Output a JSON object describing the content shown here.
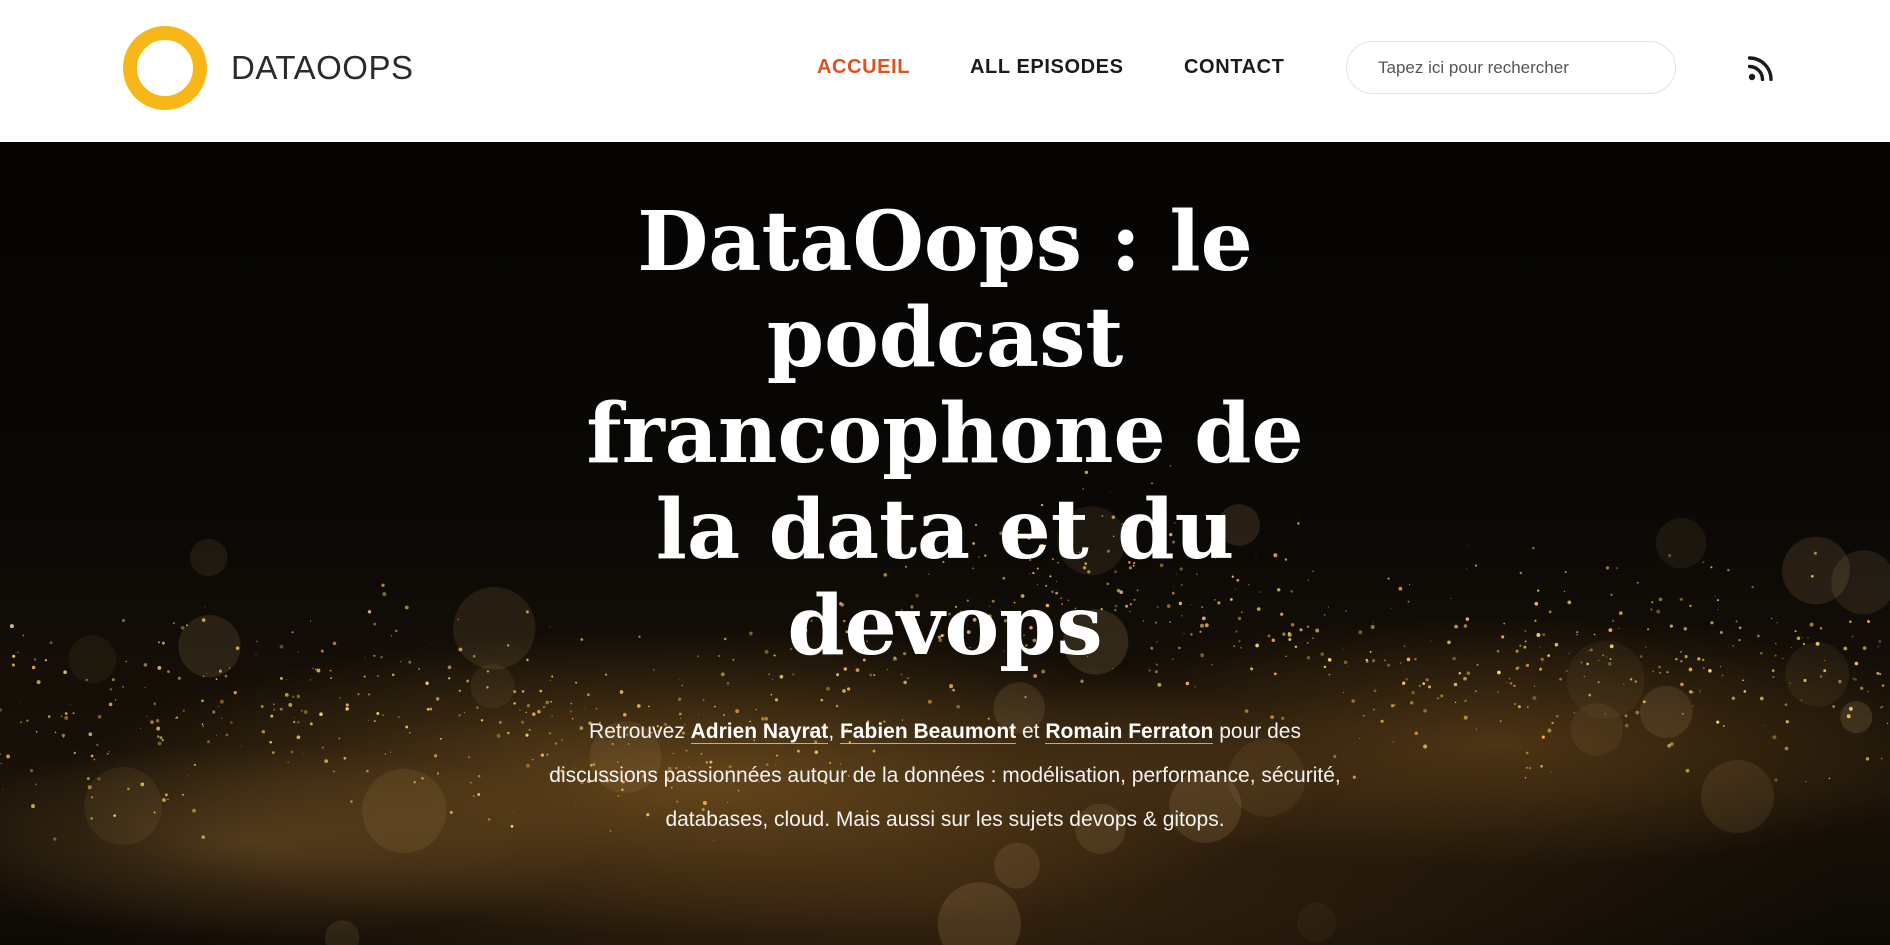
{
  "header": {
    "logo_text": "DATAOOPS",
    "nav": {
      "accueil": "ACCUEIL",
      "episodes": "ALL EPISODES",
      "contact": "CONTACT"
    },
    "search_placeholder": "Tapez ici pour rechercher",
    "rss_icon": "rss-icon"
  },
  "colors": {
    "logo_ring": "#f7b718",
    "nav_active": "#e0521d",
    "nav_text": "#1b1b1b",
    "hero_text": "#ffffff"
  },
  "hero": {
    "title": "DataOops : le podcast francophone de la data et du devops",
    "intro_prefix": "Retrouvez ",
    "host1": "Adrien Nayrat",
    "sep1": ", ",
    "host2": "Fabien Beaumont",
    "sep2": " et ",
    "host3": "Romain Ferraton",
    "intro_suffix": " pour des discussions passionnées autour de la données : modélisation, performance, sécurité, databases, cloud. Mais aussi sur les sujets devops & gitops."
  }
}
